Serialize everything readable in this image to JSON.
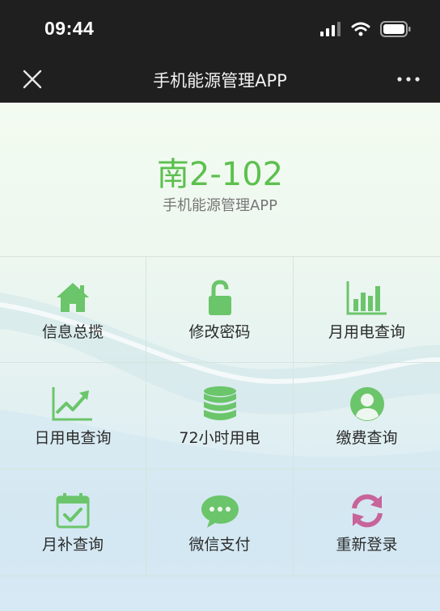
{
  "status": {
    "time": "09:44"
  },
  "nav": {
    "title": "手机能源管理APP"
  },
  "header": {
    "room": "南2-102",
    "subtitle": "手机能源管理APP"
  },
  "menu": [
    {
      "label": "信息总揽",
      "icon": "home-icon"
    },
    {
      "label": "修改密码",
      "icon": "unlock-icon"
    },
    {
      "label": "月用电查询",
      "icon": "bar-chart-icon"
    },
    {
      "label": "日用电查询",
      "icon": "line-chart-icon"
    },
    {
      "label": "72小时用电",
      "icon": "database-icon"
    },
    {
      "label": "缴费查询",
      "icon": "user-icon"
    },
    {
      "label": "月补查询",
      "icon": "calendar-check-icon"
    },
    {
      "label": "微信支付",
      "icon": "chat-icon"
    },
    {
      "label": "重新登录",
      "icon": "refresh-icon"
    }
  ],
  "colors": {
    "green": "#6bc56a",
    "pink": "#c7649a",
    "header_green": "#5cc04e"
  }
}
